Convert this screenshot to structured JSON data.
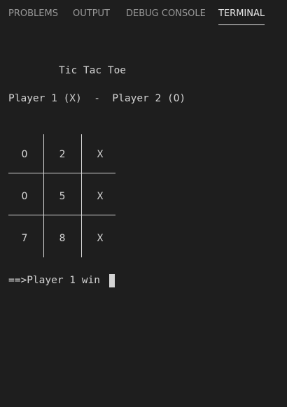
{
  "tabs": [
    {
      "label": "PROBLEMS",
      "active": false
    },
    {
      "label": "OUTPUT",
      "active": false
    },
    {
      "label": "DEBUG CONSOLE",
      "active": false
    },
    {
      "label": "TERMINAL",
      "active": true
    }
  ],
  "terminal": {
    "title": "Tic Tac Toe",
    "players": "Player 1 (X)  -  Player 2 (O)",
    "board": [
      [
        "O",
        "2",
        "X"
      ],
      [
        "O",
        "5",
        "X"
      ],
      [
        "7",
        "8",
        "X"
      ]
    ],
    "result": "==>Player 1 win"
  }
}
